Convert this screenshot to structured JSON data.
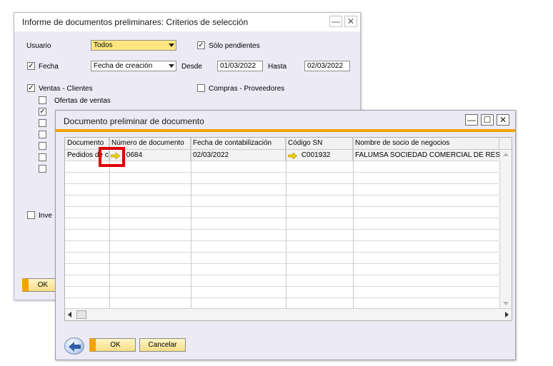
{
  "back_window": {
    "title": "Informe de documentos preliminares: Criterios de selección",
    "usuario_label": "Usuario",
    "usuario_value": "Todos",
    "solo_pendientes_label": "Sólo pendientes",
    "fecha_label": "Fecha",
    "fecha_type_value": "Fecha de creación",
    "desde_label": "Desde",
    "desde_value": "01/03/2022",
    "hasta_label": "Hasta",
    "hasta_value": "02/03/2022",
    "ventas_label": "Ventas - Clientes",
    "compras_label": "Compras - Proveedores",
    "ofertas_label": "Ofertas de ventas",
    "inve_label": "Inve",
    "ok_label": "OK"
  },
  "front_window": {
    "title": "Documento preliminar de documento",
    "columns": [
      "Documento",
      "Número de documento",
      "Fecha de contabilización",
      "Código SN",
      "Nombre de socio de negocios"
    ],
    "rows": [
      {
        "documento": "Pedidos de cl",
        "numero": "0684",
        "fecha": "02/03/2022",
        "codigo_sn": "C001932",
        "nombre": "FALUMSA SOCIEDAD COMERCIAL DE RES"
      }
    ],
    "ok_label": "OK",
    "cancel_label": "Cancelar"
  },
  "colors": {
    "window_bg": "#ecebf5",
    "accent_orange": "#f2a300",
    "highlight_box": "#e00000",
    "combo_yellow": "#ffe680"
  }
}
